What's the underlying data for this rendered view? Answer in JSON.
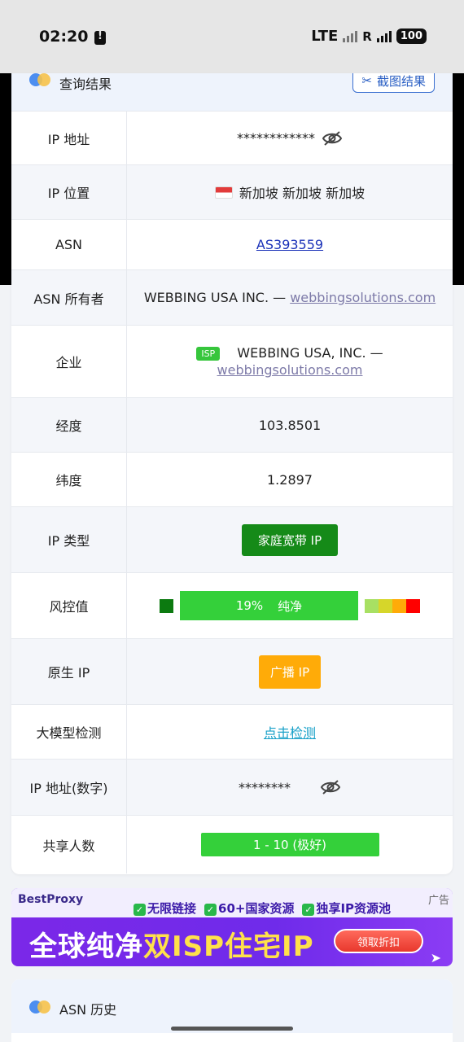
{
  "status_bar": {
    "time": "02:20",
    "network": "LTE",
    "roaming": "R",
    "battery": "100"
  },
  "result_card": {
    "title": "查询结果",
    "screenshot_button": "截图结果",
    "rows": {
      "ip_address": {
        "label": "IP 地址",
        "value": "************"
      },
      "ip_location": {
        "label": "IP 位置",
        "value": "新加坡 新加坡 新加坡"
      },
      "asn": {
        "label": "ASN",
        "value": "AS393559"
      },
      "asn_owner": {
        "label": "ASN 所有者",
        "name": "WEBBING USA INC. —",
        "domain": "webbingsolutions.com"
      },
      "company": {
        "label": "企业",
        "badge": "ISP",
        "name": "WEBBING USA, INC. —",
        "domain": "webbingsolutions.com"
      },
      "longitude": {
        "label": "经度",
        "value": "103.8501"
      },
      "latitude": {
        "label": "纬度",
        "value": "1.2897"
      },
      "ip_type": {
        "label": "IP 类型",
        "value": "家庭宽带 IP"
      },
      "risk": {
        "label": "风控值",
        "percent": "19%",
        "text": "纯净"
      },
      "native_ip": {
        "label": "原生 IP",
        "value": "广播 IP"
      },
      "llm_detect": {
        "label": "大模型检测",
        "value": "点击检测"
      },
      "ip_numeric": {
        "label": "IP 地址(数字)",
        "value": "********"
      },
      "shared_users": {
        "label": "共享人数",
        "value": "1 - 10 (极好)"
      }
    }
  },
  "ad": {
    "brand": "BestProxy",
    "features": [
      "无限链接",
      "60+国家资源",
      "独享IP资源池"
    ],
    "tag": "广告",
    "headline_part1": "全球纯净",
    "headline_part2": "双ISP住宅IP",
    "cta": "领取折扣"
  },
  "asn_history_card": {
    "title": "ASN 历史"
  },
  "colors": {
    "accent_blue": "#2a5fc4",
    "risk_green": "#34d03a",
    "ip_type_green": "#158a18",
    "native_orange": "#ffab08",
    "risk_scale": [
      "#a8e063",
      "#d6d62a",
      "#ffab08",
      "#ff0000"
    ]
  },
  "icons": {
    "eye_off": "eye-off-icon",
    "scissors": "scissors-icon",
    "flag": "singapore-flag-icon"
  }
}
